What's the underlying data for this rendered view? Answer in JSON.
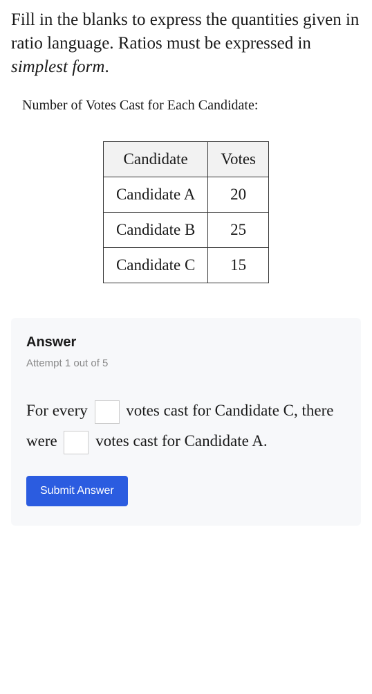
{
  "instructions": {
    "prefix": "Fill in the blanks to express the quantities given in ratio language. Ratios must be expressed in ",
    "emphasis": "simplest form",
    "suffix": "."
  },
  "table": {
    "title": "Number of Votes Cast for Each Candidate:",
    "headers": {
      "col1": "Candidate",
      "col2": "Votes"
    },
    "rows": [
      {
        "candidate": "Candidate A",
        "votes": "20"
      },
      {
        "candidate": "Candidate B",
        "votes": "25"
      },
      {
        "candidate": "Candidate C",
        "votes": "15"
      }
    ]
  },
  "answer": {
    "heading": "Answer",
    "attempt": "Attempt 1 out of 5",
    "sentence": {
      "part1": "For every ",
      "part2": " votes cast for Candidate C, there were ",
      "part3": " votes cast for Candidate A."
    },
    "blank1": "",
    "blank2": "",
    "submit_label": "Submit Answer"
  },
  "chart_data": {
    "type": "table",
    "title": "Number of Votes Cast for Each Candidate:",
    "columns": [
      "Candidate",
      "Votes"
    ],
    "rows": [
      [
        "Candidate A",
        20
      ],
      [
        "Candidate B",
        25
      ],
      [
        "Candidate C",
        15
      ]
    ]
  }
}
